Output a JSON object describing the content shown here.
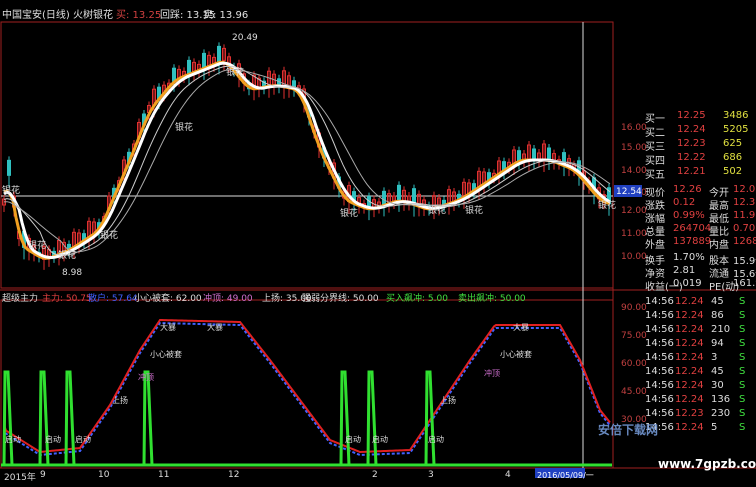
{
  "title_bar": {
    "title": "中国宝安(日线) 火树银花",
    "buy": "买: 13.25",
    "pullback": "回踩: 13.15",
    "sell": "卖: 13.96"
  },
  "main_chart": {
    "y_ticks": [
      "16.00",
      "15.00",
      "14.00",
      "13.00",
      "12.00",
      "11.00",
      "10.00"
    ],
    "current_price": "12.54",
    "high_label": "20.49",
    "low_label": "8.98",
    "flower_label": "银花"
  },
  "quotes": {
    "levels": [
      {
        "name": "买一",
        "price": "12.25",
        "vol": "3486"
      },
      {
        "name": "买二",
        "price": "12.24",
        "vol": "5205"
      },
      {
        "name": "买三",
        "price": "12.23",
        "vol": "625"
      },
      {
        "name": "买四",
        "price": "12.22",
        "vol": "686"
      },
      {
        "name": "买五",
        "price": "12.21",
        "vol": "502"
      }
    ],
    "stats": [
      {
        "l1": "现价",
        "v1": "12.26",
        "l2": "今开",
        "v2": "12.01"
      },
      {
        "l1": "涨跌",
        "v1": "0.12",
        "l2": "最高",
        "v2": "12.35"
      },
      {
        "l1": "涨幅",
        "v1": "0.99%",
        "l2": "最低",
        "v2": "11.95"
      },
      {
        "l1": "总量",
        "v1": "264704",
        "l2": "量比",
        "v2": "0.70"
      },
      {
        "l1": "外盘",
        "v1": "137889",
        "l2": "内盘",
        "v2": "126815"
      }
    ],
    "fin": [
      {
        "l1": "换手",
        "v1": "1.70%",
        "l2": "股本",
        "v2": "15.9亿"
      },
      {
        "l1": "净资",
        "v1": "2.81",
        "l2": "流通",
        "v2": "15.6亿"
      },
      {
        "l1": "收益(一)",
        "v1": "0.019",
        "l2": "PE(动)",
        "v2": "161.9"
      }
    ],
    "ticks": [
      {
        "time": "14:56",
        "price": "12.24",
        "vol": "45",
        "side": "S"
      },
      {
        "time": "14:56",
        "price": "12.24",
        "vol": "86",
        "side": "S"
      },
      {
        "time": "14:56",
        "price": "12.24",
        "vol": "210",
        "side": "S"
      },
      {
        "time": "14:56",
        "price": "12.24",
        "vol": "94",
        "side": "S"
      },
      {
        "time": "14:56",
        "price": "12.24",
        "vol": "3",
        "side": "S"
      },
      {
        "time": "14:56",
        "price": "12.24",
        "vol": "45",
        "side": "S"
      },
      {
        "time": "14:56",
        "price": "12.24",
        "vol": "30",
        "side": "S"
      },
      {
        "time": "14:56",
        "price": "12.24",
        "vol": "136",
        "side": "S"
      },
      {
        "time": "14:56",
        "price": "12.23",
        "vol": "230",
        "side": "S"
      },
      {
        "time": "14:56",
        "price": "12.24",
        "vol": "5",
        "side": "S"
      }
    ]
  },
  "indicator": {
    "name": "超级主力",
    "zhuli": "主力: 50.75",
    "sanhu": "散户: 57.64",
    "xiaoxin": "小心被套: 62.00",
    "chongpo": "冲顶: 49.00",
    "shangzhang": "上扬: 35.00",
    "qiangruo": "强弱分界线: 50.00",
    "mairu": "买入飙冲: 5.00",
    "maichu": "卖出飙冲: 50.00",
    "y_ticks": [
      "90.00",
      "75.00",
      "60.00",
      "45.00",
      "30.00"
    ],
    "annotations": {
      "dabao": "大暴",
      "xiaoxin": "小心被套",
      "chongpo": "冲顶",
      "shang": "上扬",
      "qidong": "启动"
    }
  },
  "x_axis": {
    "labels": [
      "2015年",
      "9",
      "10",
      "11",
      "12",
      "2",
      "3",
      "4",
      "2016/05/09/一"
    ]
  },
  "watermark": "安倍下载网",
  "site_url": "www.7gpzb.com"
}
